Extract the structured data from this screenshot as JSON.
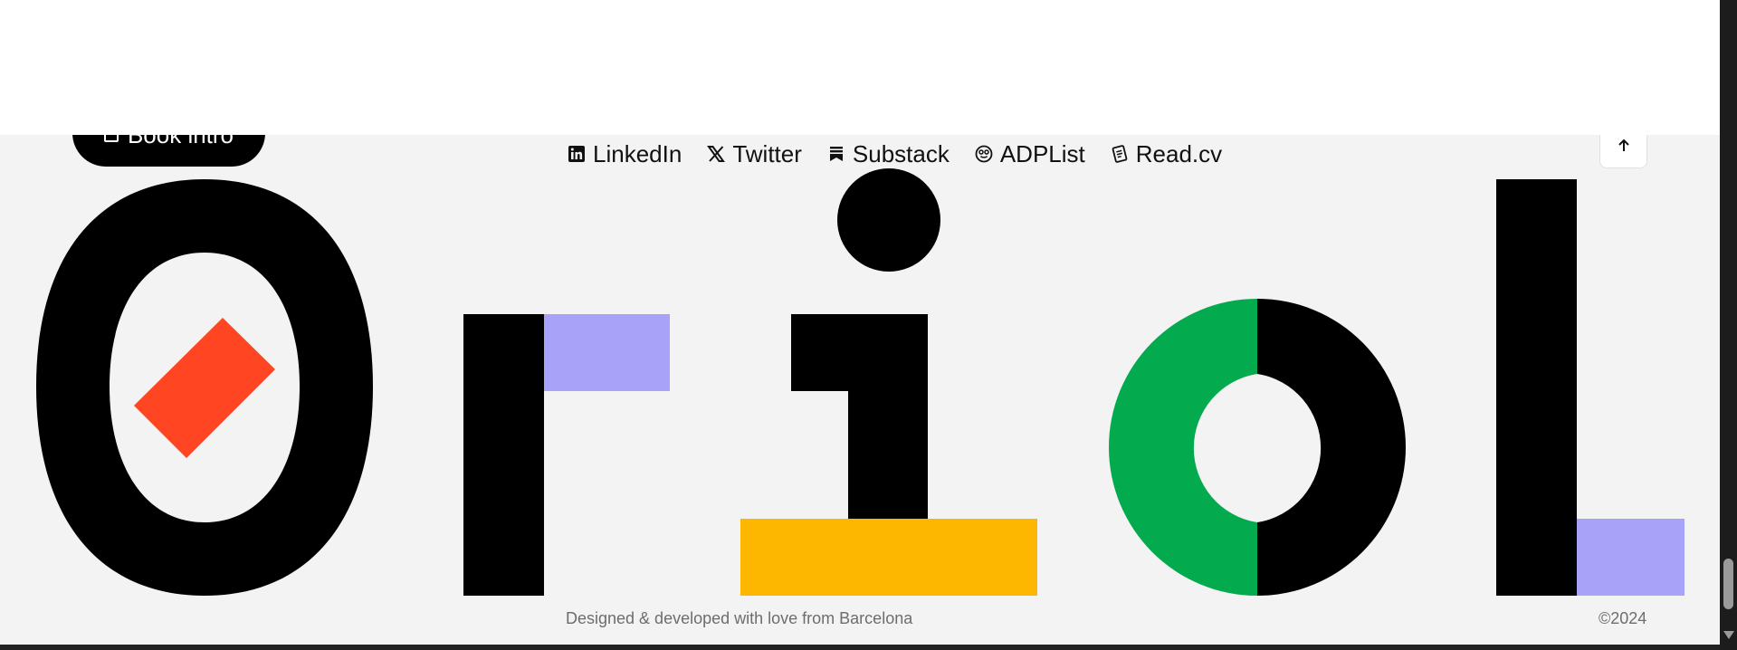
{
  "header": {
    "book_label": "Book intro"
  },
  "social_links": [
    {
      "label": "LinkedIn",
      "icon": "linkedin-icon"
    },
    {
      "label": "Twitter",
      "icon": "x-twitter-icon"
    },
    {
      "label": "Substack",
      "icon": "substack-icon"
    },
    {
      "label": "ADPList",
      "icon": "adplist-icon"
    },
    {
      "label": "Read.cv",
      "icon": "readcv-icon"
    }
  ],
  "scroll_top": {
    "icon": "arrow-up-icon"
  },
  "logo": {
    "word": "Oriol",
    "colors": {
      "black": "#000000",
      "orange": "#ff4521",
      "lavender": "#a8a3f8",
      "yellow": "#fdb700",
      "green": "#04aa4e",
      "background": "#f3f3f3"
    }
  },
  "footer": {
    "credit": "Designed & developed with love from Barcelona",
    "copyright": "©2024"
  }
}
